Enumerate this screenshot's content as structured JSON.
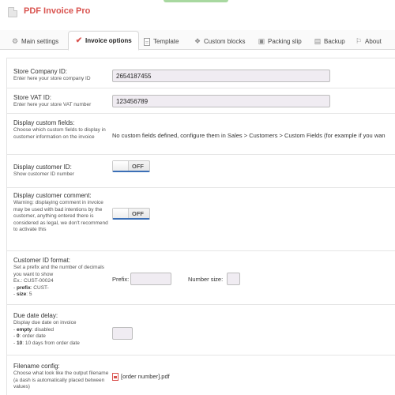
{
  "header": {
    "title": "PDF Invoice Pro",
    "logo_icon": "pdf-document-icon",
    "title_color": "#d9534f"
  },
  "tabs": [
    {
      "label": "Main settings",
      "icon": "gear-icon",
      "active": false
    },
    {
      "label": "Invoice options",
      "icon": "checkmark-icon",
      "active": true
    },
    {
      "label": "Template",
      "icon": "document-icon",
      "active": false
    },
    {
      "label": "Custom blocks",
      "icon": "puzzle-icon",
      "active": false
    },
    {
      "label": "Packing slip",
      "icon": "box-icon",
      "active": false
    },
    {
      "label": "Backup",
      "icon": "backup-icon",
      "active": false
    },
    {
      "label": "About",
      "icon": "info-icon",
      "active": false
    }
  ],
  "fields": {
    "company_id": {
      "label": "Store Company ID:",
      "help": "Enter here your store company ID",
      "value": "2654187455"
    },
    "vat_id": {
      "label": "Store VAT ID:",
      "help": "Enter here your store VAT number",
      "value": "123456789"
    },
    "custom_fields": {
      "label": "Display custom fields:",
      "help": "Choose which custom fields to display in customer information on the invoice",
      "message": "No custom fields defined, configure them in Sales > Customers > Custom Fields (for example if you wan"
    },
    "customer_id": {
      "label": "Display customer ID:",
      "help": "Show customer ID number",
      "state": "OFF"
    },
    "customer_comment": {
      "label": "Display customer comment:",
      "help": "Warning: displaying comment in invoice may be used with bad intentions by the customer, anything entered there is considered as legal, we don't recommend to activate this",
      "state": "OFF"
    },
    "customer_id_format": {
      "label": "Customer ID format:",
      "help_line1": "Set a prefix and the number of decimals you want to show",
      "help_line2": "Ex.: CUST-00024",
      "help_prefix_key": "prefix",
      "help_prefix_val": ": CUST-",
      "help_size_key": "size",
      "help_size_val": ": 5",
      "prefix_label": "Prefix:",
      "prefix_value": "",
      "size_label": "Number size:",
      "size_value": ""
    },
    "due_date": {
      "label": "Due date delay:",
      "help_line1": "Display due date on invoice",
      "empty_key": "empty",
      "empty_val": ": disabled",
      "zero_key": "0",
      "zero_val": ": order date",
      "ten_key": "10",
      "ten_val": ": 10 days from order date",
      "value": ""
    },
    "filename": {
      "label": "Filename config:",
      "help": "Choose what look like the output filename (a dash is automatically placed between values)",
      "value": "[order number].pdf"
    }
  },
  "colors": {
    "accent": "#d9534f",
    "toggle_underline": "#3b6fb6",
    "input_bg": "#f0ecf2"
  }
}
